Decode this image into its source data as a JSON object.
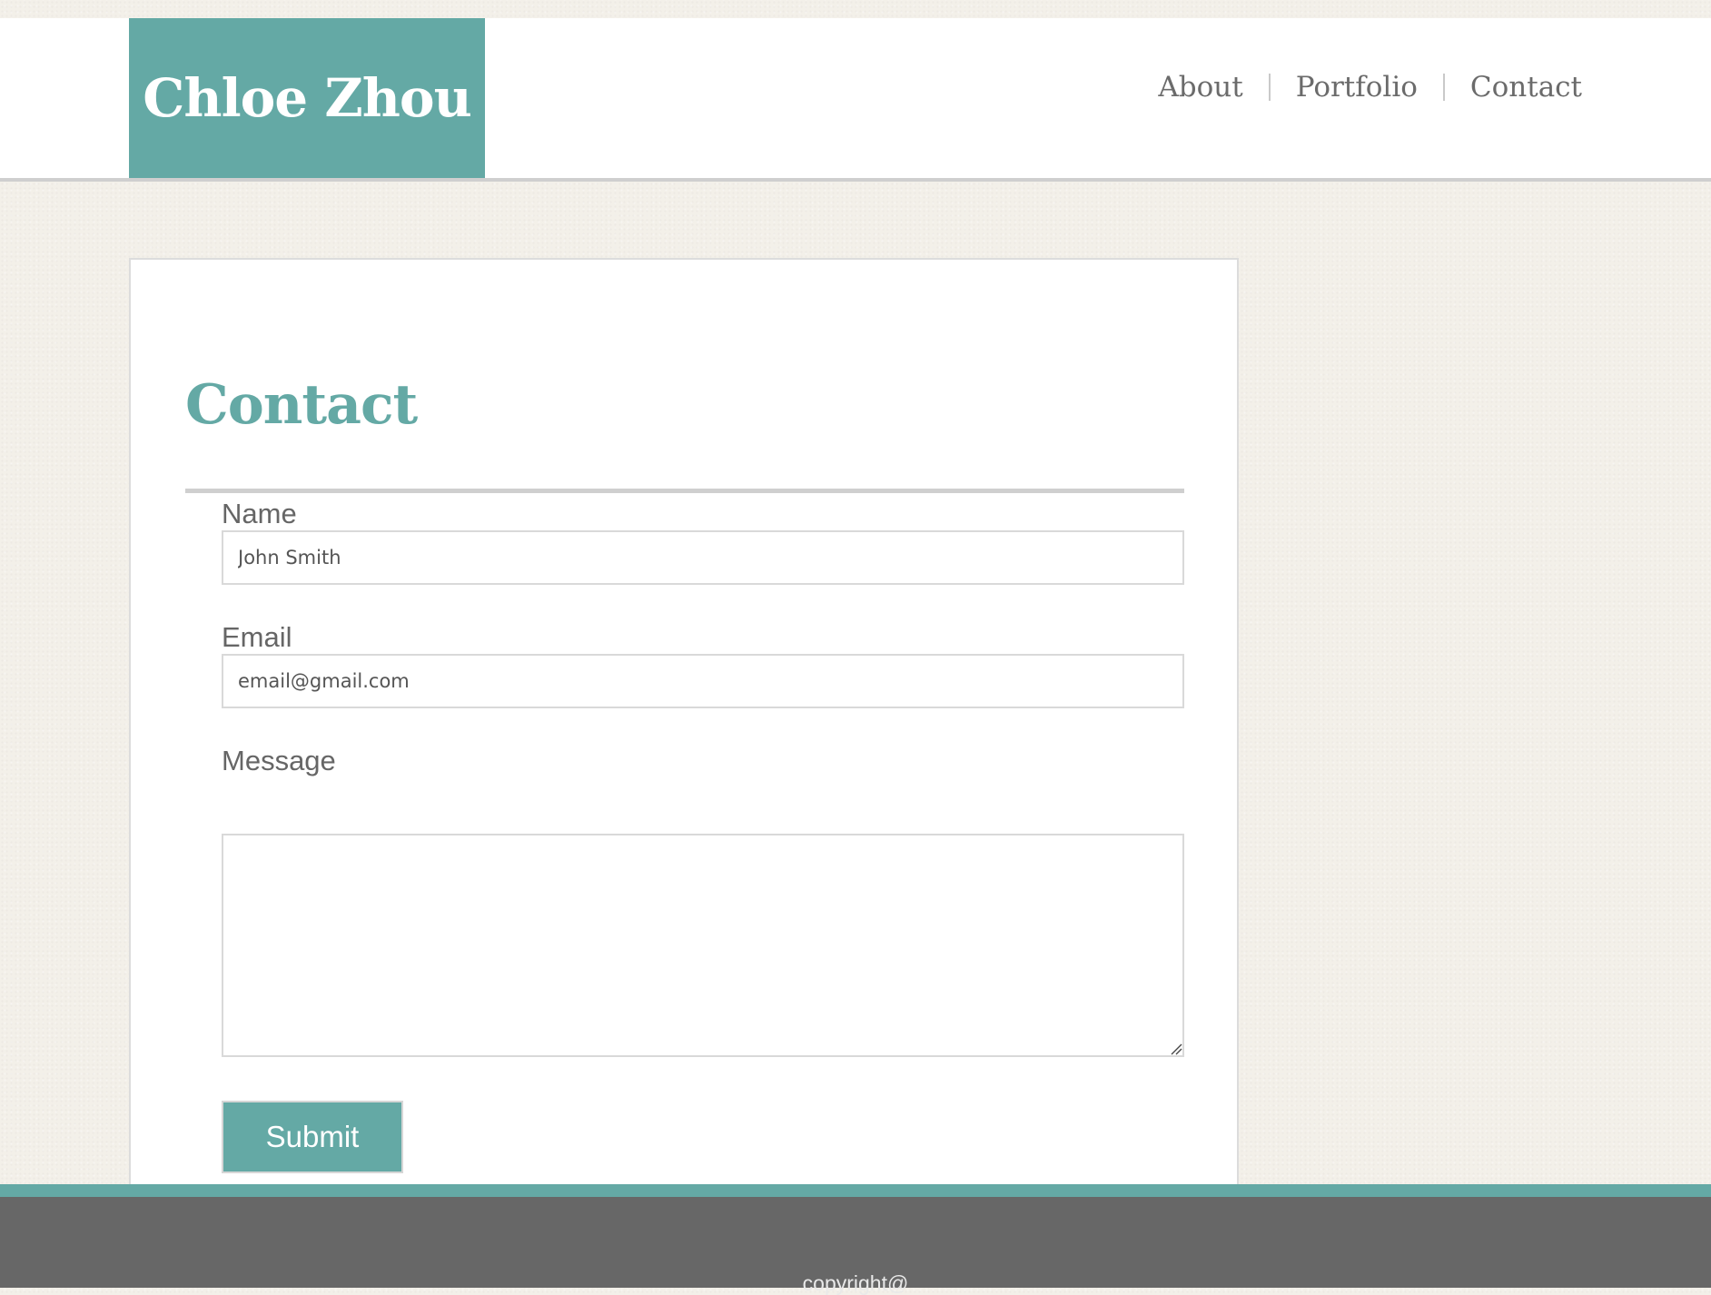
{
  "header": {
    "brand": "Chloe Zhou",
    "nav": [
      "About",
      "Portfolio",
      "Contact"
    ]
  },
  "contact": {
    "title": "Contact",
    "fields": {
      "name": {
        "label": "Name",
        "placeholder": "John Smith"
      },
      "email": {
        "label": "Email",
        "placeholder": "email@gmail.com"
      },
      "message": {
        "label": "Message",
        "placeholder": ""
      }
    },
    "submit_label": "Submit"
  },
  "footer": {
    "text": "copyright@"
  },
  "colors": {
    "accent": "#64a9a5",
    "footer_bg": "#676767",
    "page_bg": "#f3f0e9",
    "text_gray": "#6b6b6b"
  }
}
